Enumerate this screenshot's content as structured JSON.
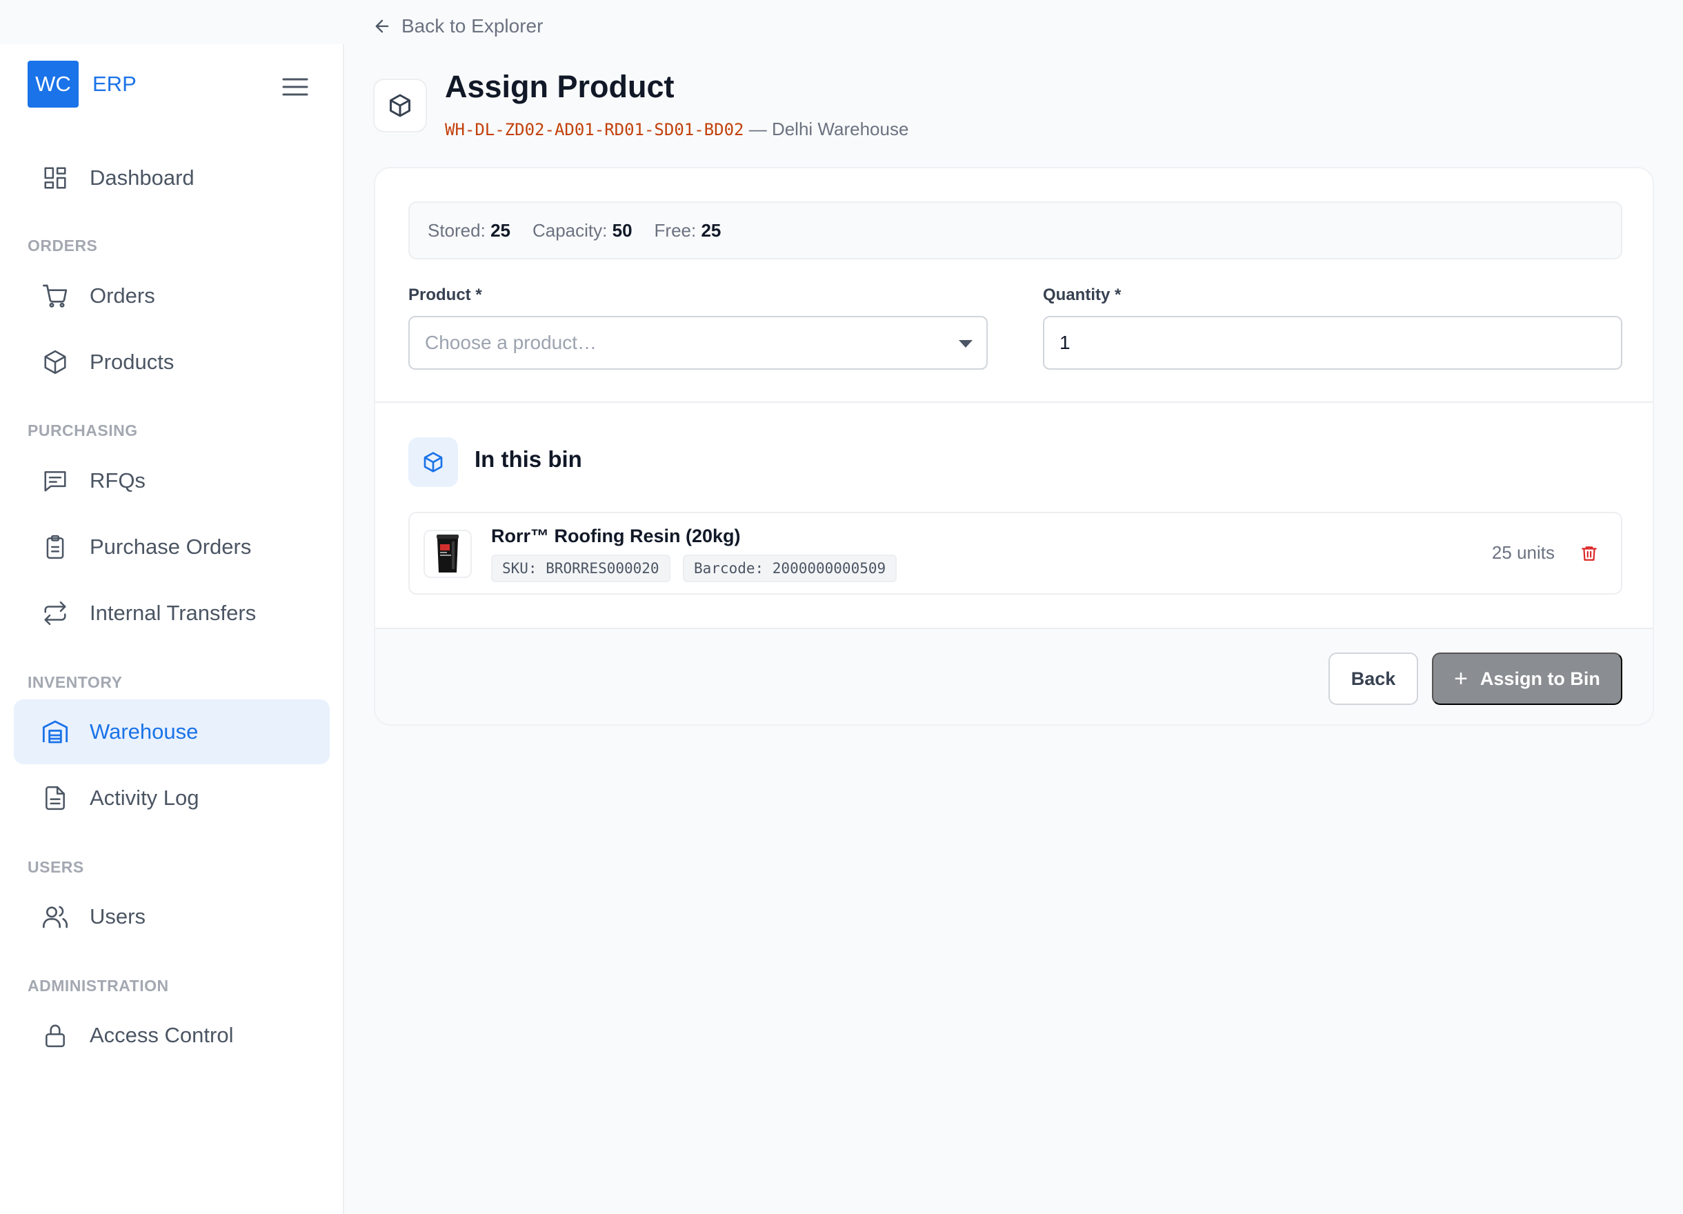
{
  "top": {
    "back_label": "Back to Explorer"
  },
  "brand": {
    "logo_text": "WC",
    "name": "ERP"
  },
  "sidebar": {
    "dashboard": "Dashboard",
    "sections": {
      "orders": "ORDERS",
      "purchasing": "PURCHASING",
      "inventory": "INVENTORY",
      "users": "USERS",
      "administration": "ADMINISTRATION"
    },
    "items": {
      "orders": "Orders",
      "products": "Products",
      "rfqs": "RFQs",
      "purchase_orders": "Purchase Orders",
      "internal_transfers": "Internal Transfers",
      "warehouse": "Warehouse",
      "activity_log": "Activity Log",
      "users": "Users",
      "access_control": "Access Control"
    },
    "active": "warehouse"
  },
  "header": {
    "title": "Assign Product",
    "bin_code": "WH-DL-ZD02-AD01-RD01-SD01-BD02",
    "separator": " — ",
    "warehouse": "Delhi Warehouse"
  },
  "stats": {
    "stored_label": "Stored:",
    "stored_value": "25",
    "capacity_label": "Capacity:",
    "capacity_value": "50",
    "free_label": "Free:",
    "free_value": "25"
  },
  "form": {
    "product_label": "Product *",
    "product_placeholder": "Choose a product…",
    "quantity_label": "Quantity *",
    "quantity_value": "1"
  },
  "bin": {
    "title": "In this bin",
    "items": [
      {
        "name": "Rorr™ Roofing Resin (20kg)",
        "sku": "SKU: BRORRES000020",
        "barcode": "Barcode: 2000000000509",
        "quantity": "25 units"
      }
    ]
  },
  "actions": {
    "back_label": "Back",
    "assign_label": "Assign to Bin"
  },
  "colors": {
    "accent": "#1a73e8",
    "bin_code": "#c2410c",
    "danger": "#dc2626",
    "disabled_button": "#8a8d91"
  }
}
